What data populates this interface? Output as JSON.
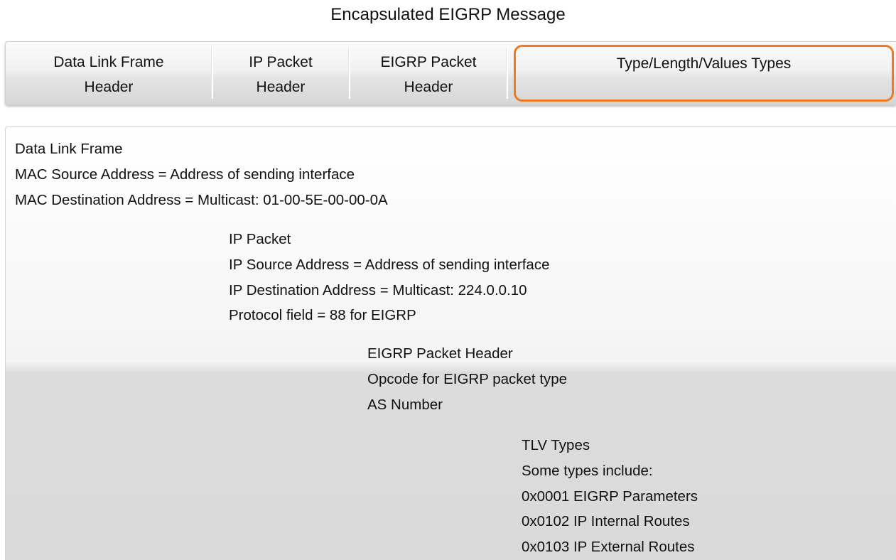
{
  "title": "Encapsulated EIGRP Message",
  "tabs": [
    {
      "line1": "Data Link Frame",
      "line2": "Header"
    },
    {
      "line1": "IP Packet",
      "line2": "Header"
    },
    {
      "line1": "EIGRP Packet",
      "line2": "Header"
    },
    {
      "line1": "Type/Length/Values Types",
      "line2": ""
    }
  ],
  "selected_tab": "Type/Length/Values Types",
  "highlight_color": "#f07a22",
  "sections": {
    "data_link": {
      "heading": "Data Link Frame",
      "lines": [
        "MAC Source Address = Address of sending interface",
        "MAC Destination Address = Multicast: 01-00-5E-00-00-0A"
      ]
    },
    "ip_packet": {
      "heading": "IP Packet",
      "lines": [
        "IP Source Address = Address of sending interface",
        "IP Destination Address = Multicast: 224.0.0.10",
        "Protocol field = 88 for EIGRP"
      ]
    },
    "eigrp_header": {
      "heading": "EIGRP Packet Header",
      "lines": [
        "Opcode for EIGRP packet type",
        "AS Number"
      ]
    },
    "tlv_types": {
      "heading": "TLV Types",
      "lines": [
        "Some types include:",
        "0x0001 EIGRP Parameters",
        "0x0102 IP Internal Routes",
        "0x0103 IP External Routes"
      ]
    }
  }
}
